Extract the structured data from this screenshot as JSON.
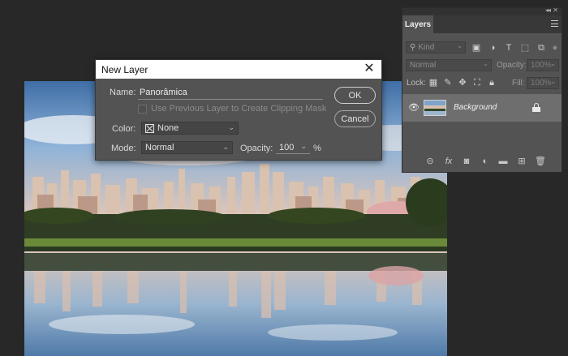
{
  "dialog": {
    "title": "New Layer",
    "name_label": "Name:",
    "name_value": "Panorâmica",
    "clip_checkbox_label": "Use Previous Layer to Create Clipping Mask",
    "color_label": "Color:",
    "color_value": "None",
    "mode_label": "Mode:",
    "mode_value": "Normal",
    "opacity_label": "Opacity:",
    "opacity_value": "100",
    "opacity_unit": "%",
    "ok_label": "OK",
    "cancel_label": "Cancel",
    "close_glyph": "✕"
  },
  "layers_panel": {
    "tab_label": "Layers",
    "collapse_glyph": "◂◂",
    "close_glyph": "✕",
    "filter_kind": "Kind",
    "blend_mode": "Normal",
    "opacity_label": "Opacity:",
    "opacity_value": "100%",
    "lock_label": "Lock:",
    "fill_label": "Fill:",
    "fill_value": "100%",
    "layers": [
      {
        "name": "Background",
        "visible": true,
        "locked": true
      }
    ],
    "bottom_icons": [
      "link-icon",
      "fx-icon",
      "mask-icon",
      "adjustment-icon",
      "folder-icon",
      "new-layer-icon",
      "trash-icon"
    ],
    "fx_glyph": "fx"
  },
  "colors": {
    "workspace": "#282828",
    "panel": "#535353",
    "selected_layer": "#6e6e6e",
    "dialog_titlebar": "#ffffff"
  }
}
